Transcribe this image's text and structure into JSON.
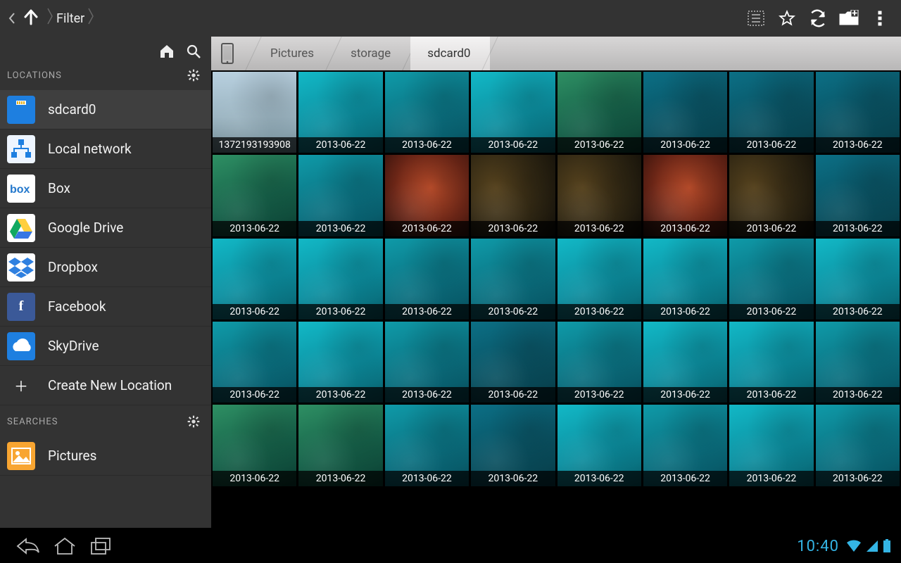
{
  "topbar": {
    "filter_label": "Filter",
    "actions": {
      "select_mode": "select-list",
      "favorite": "star",
      "refresh": "refresh",
      "new_folder": "new-folder",
      "overflow": "overflow"
    }
  },
  "sidebar": {
    "locations_header": "LOCATIONS",
    "searches_header": "SEARCHES",
    "items": [
      {
        "id": "sdcard0",
        "label": "sdcard0",
        "icon": "sd-card",
        "selected": true
      },
      {
        "id": "local-network",
        "label": "Local network",
        "icon": "lan"
      },
      {
        "id": "box",
        "label": "Box",
        "icon": "box"
      },
      {
        "id": "google-drive",
        "label": "Google Drive",
        "icon": "google-drive"
      },
      {
        "id": "dropbox",
        "label": "Dropbox",
        "icon": "dropbox"
      },
      {
        "id": "facebook",
        "label": "Facebook",
        "icon": "facebook"
      },
      {
        "id": "skydrive",
        "label": "SkyDrive",
        "icon": "skydrive"
      }
    ],
    "create_new_location_label": "Create New Location",
    "searches": [
      {
        "id": "pictures",
        "label": "Pictures",
        "icon": "pictures"
      }
    ]
  },
  "breadcrumb": {
    "items": [
      {
        "id": "device",
        "label": "",
        "icon": "phone"
      },
      {
        "id": "pictures",
        "label": "Pictures"
      },
      {
        "id": "storage",
        "label": "storage"
      },
      {
        "id": "sdcard0",
        "label": "sdcard0",
        "active": true
      }
    ]
  },
  "grid": {
    "thumbs": [
      {
        "caption": "1372193193908",
        "variant": "u7"
      },
      {
        "caption": "2013-06-22",
        "variant": "u2"
      },
      {
        "caption": "2013-06-22",
        "variant": "u1"
      },
      {
        "caption": "2013-06-22",
        "variant": "u2"
      },
      {
        "caption": "2013-06-22",
        "variant": "u5"
      },
      {
        "caption": "2013-06-22",
        "variant": "u3"
      },
      {
        "caption": "2013-06-22",
        "variant": "u3"
      },
      {
        "caption": "2013-06-22",
        "variant": "u3"
      },
      {
        "caption": "2013-06-22",
        "variant": "u5"
      },
      {
        "caption": "2013-06-22",
        "variant": "u1"
      },
      {
        "caption": "2013-06-22",
        "variant": "u6"
      },
      {
        "caption": "2013-06-22",
        "variant": "u4"
      },
      {
        "caption": "2013-06-22",
        "variant": "u4"
      },
      {
        "caption": "2013-06-22",
        "variant": "u6"
      },
      {
        "caption": "2013-06-22",
        "variant": "u4"
      },
      {
        "caption": "2013-06-22",
        "variant": "u3"
      },
      {
        "caption": "2013-06-22",
        "variant": "u2"
      },
      {
        "caption": "2013-06-22",
        "variant": "u2"
      },
      {
        "caption": "2013-06-22",
        "variant": "u1"
      },
      {
        "caption": "2013-06-22",
        "variant": "u1"
      },
      {
        "caption": "2013-06-22",
        "variant": "u2"
      },
      {
        "caption": "2013-06-22",
        "variant": "u2"
      },
      {
        "caption": "2013-06-22",
        "variant": "u1"
      },
      {
        "caption": "2013-06-22",
        "variant": "u2"
      },
      {
        "caption": "2013-06-22",
        "variant": "u1"
      },
      {
        "caption": "2013-06-22",
        "variant": "u2"
      },
      {
        "caption": "2013-06-22",
        "variant": "u1"
      },
      {
        "caption": "2013-06-22",
        "variant": "u3"
      },
      {
        "caption": "2013-06-22",
        "variant": "u1"
      },
      {
        "caption": "2013-06-22",
        "variant": "u2"
      },
      {
        "caption": "2013-06-22",
        "variant": "u2"
      },
      {
        "caption": "2013-06-22",
        "variant": "u1"
      },
      {
        "caption": "2013-06-22",
        "variant": "u5"
      },
      {
        "caption": "2013-06-22",
        "variant": "u5"
      },
      {
        "caption": "2013-06-22",
        "variant": "u1"
      },
      {
        "caption": "2013-06-22",
        "variant": "u3"
      },
      {
        "caption": "2013-06-22",
        "variant": "u2"
      },
      {
        "caption": "2013-06-22",
        "variant": "u1"
      },
      {
        "caption": "2013-06-22",
        "variant": "u2"
      },
      {
        "caption": "2013-06-22",
        "variant": "u1"
      }
    ]
  },
  "navbar": {
    "time": "10:40"
  }
}
